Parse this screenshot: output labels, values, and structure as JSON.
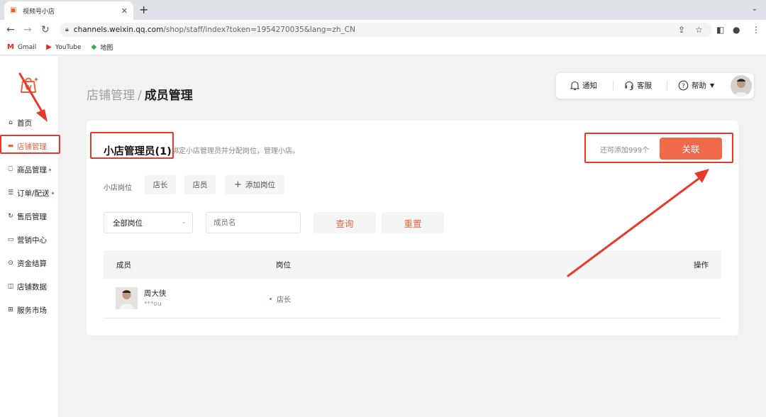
{
  "browser": {
    "tab_title": "视频号小店",
    "url_host": "channels.weixin.qq.com",
    "url_path": "/shop/staff/index?token=1954270035&lang=zh_CN",
    "bookmarks": [
      {
        "label": "Gmail"
      },
      {
        "label": "YouTube"
      },
      {
        "label": "地图"
      }
    ]
  },
  "sidebar": {
    "items": [
      {
        "label": "首页",
        "icon": "home-icon"
      },
      {
        "label": "店铺管理",
        "icon": "store-icon",
        "active": true
      },
      {
        "label": "商品管理",
        "icon": "bag-icon",
        "dot": true
      },
      {
        "label": "订单/配送",
        "icon": "order-icon",
        "dot": true
      },
      {
        "label": "售后管理",
        "icon": "refresh-icon"
      },
      {
        "label": "营销中心",
        "icon": "ticket-icon"
      },
      {
        "label": "资金结算",
        "icon": "coin-icon"
      },
      {
        "label": "店铺数据",
        "icon": "chart-icon"
      },
      {
        "label": "服务市场",
        "icon": "grid-icon"
      }
    ]
  },
  "header": {
    "breadcrumb_parent": "店铺管理",
    "breadcrumb_sep": "/",
    "breadcrumb_current": "成员管理",
    "notify": "通知",
    "service": "客服",
    "help": "帮助"
  },
  "card": {
    "title": "小店管理员(1)",
    "desc": "绑定小店管理员并分配岗位，管理小店。",
    "quota": "还可添加999个",
    "link_button": "关联",
    "positions_label": "小店岗位",
    "positions": [
      "店长",
      "店员"
    ],
    "add_position": "添加岗位",
    "filter": {
      "select_value": "全部岗位",
      "name_placeholder": "成员名",
      "query": "查询",
      "reset": "重置"
    },
    "table": {
      "columns": [
        "成员",
        "岗位",
        "操作"
      ],
      "rows": [
        {
          "name": "周大侠",
          "id": "***ou",
          "position": "店长"
        }
      ]
    }
  },
  "colors": {
    "accent": "#ee6a4a",
    "annotation": "#e8392a"
  }
}
